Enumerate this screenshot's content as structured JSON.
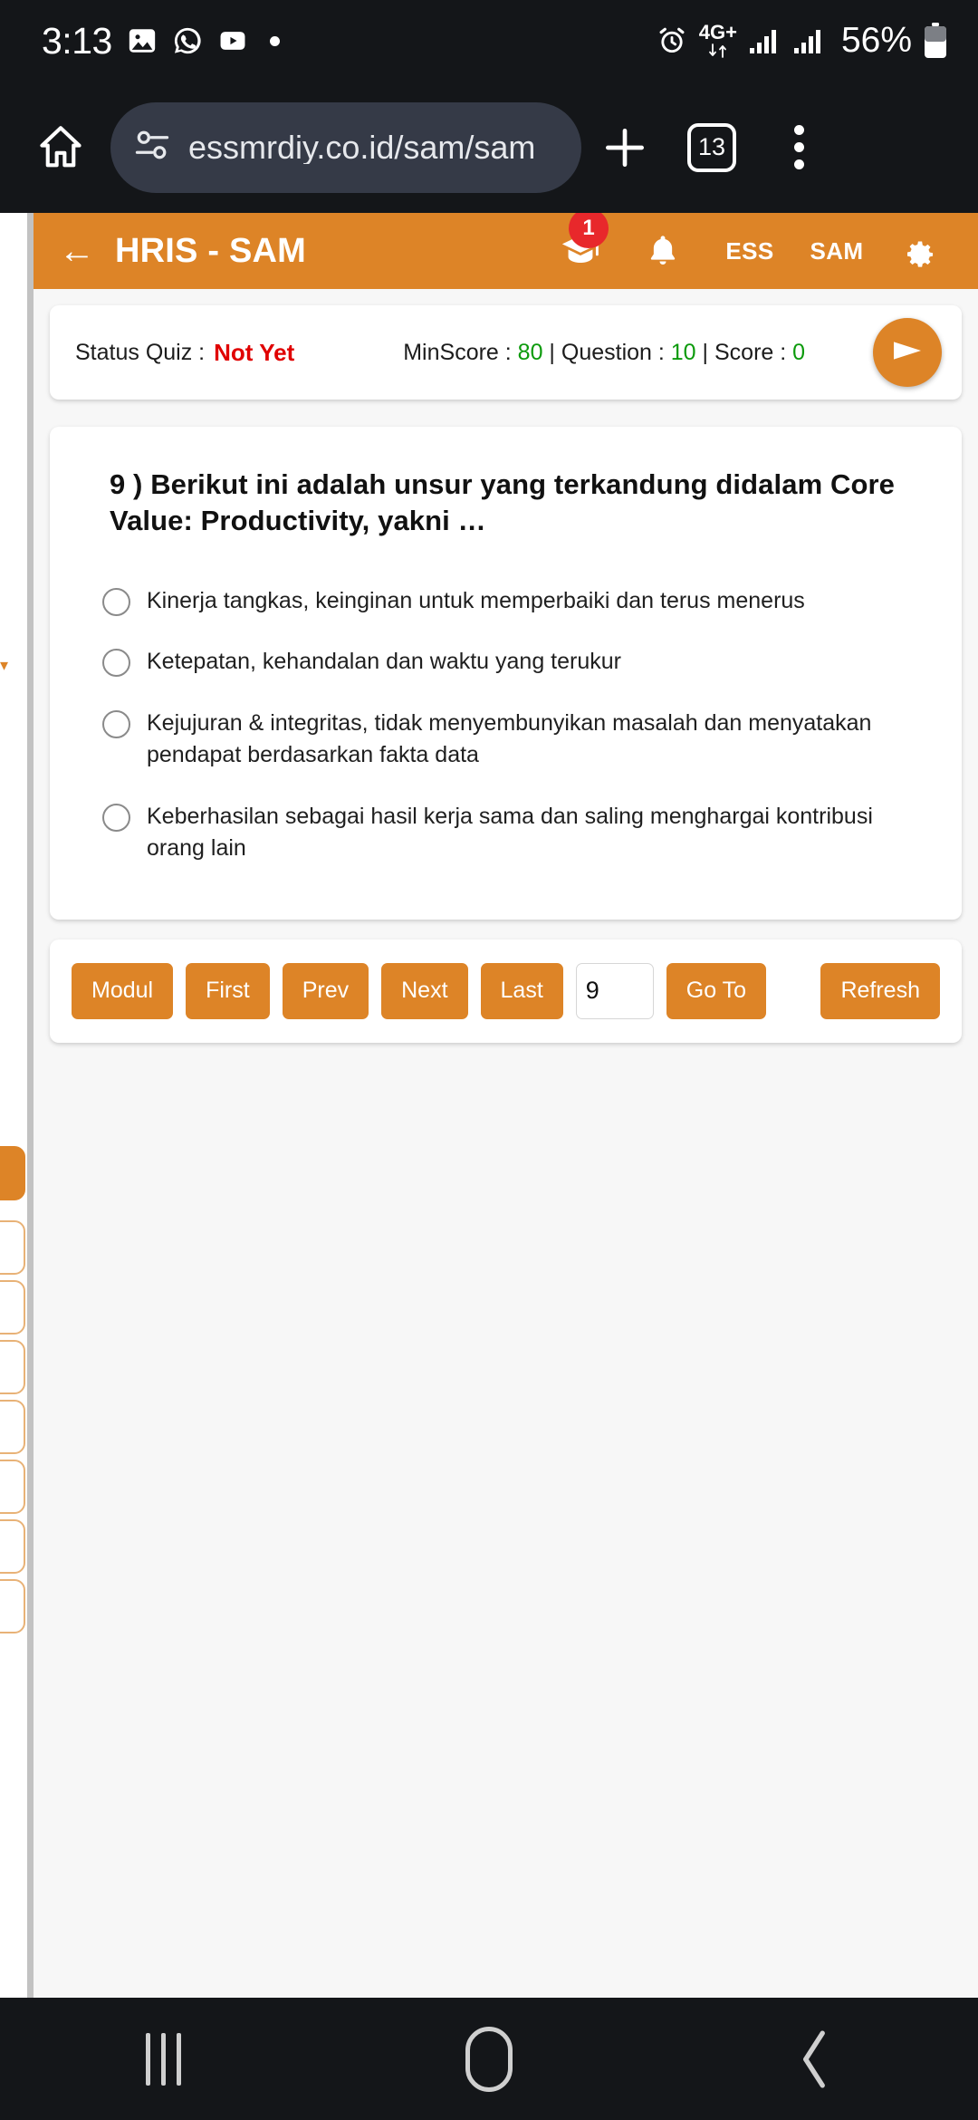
{
  "status_bar": {
    "time": "3:13",
    "left_icons": [
      "photos-icon",
      "whatsapp-icon",
      "youtube-icon",
      "more-notifications-dot"
    ],
    "alarm_icon": "alarm-icon",
    "network_type": "4G+",
    "signal_bars": [
      "signal-icon-sim1",
      "signal-icon-sim2"
    ],
    "battery_percent": "56%",
    "battery_icon": "battery-icon"
  },
  "browser": {
    "home_icon": "home-icon",
    "site_info_icon": "site-settings-icon",
    "url": "essmrdiy.co.id/sam/sam",
    "new_tab_icon": "plus-icon",
    "tab_count": "13",
    "menu_icon": "overflow-menu-icon"
  },
  "app_header": {
    "back_icon": "back-arrow-icon",
    "title": "HRIS - SAM",
    "learning_icon": "graduation-cap-icon",
    "learning_badge": "1",
    "notification_icon": "bell-icon",
    "ess_label": "ESS",
    "sam_label": "SAM",
    "settings_icon": "gear-icon",
    "accent_color": "#dd8427"
  },
  "status_card": {
    "status_label": "Status Quiz :",
    "status_value": "Not Yet",
    "status_value_color": "#e00000",
    "minscore_label": "MinScore :",
    "minscore_value": "80",
    "question_label": "Question :",
    "question_value": "10",
    "score_label": "Score :",
    "score_value": "0",
    "value_color": "#0b9a0b",
    "submit_icon": "send-arrow-icon"
  },
  "quiz": {
    "question_text": "9 ) Berikut ini adalah unsur yang terkandung didalam Core Value: Productivity, yakni …",
    "options": [
      {
        "text": "Kinerja tangkas, keinginan untuk memperbaiki dan terus menerus",
        "selected": false
      },
      {
        "text": "Ketepatan, kehandalan dan waktu yang terukur",
        "selected": false
      },
      {
        "text": "Kejujuran & integritas, tidak menyembunyikan masalah dan menyatakan pendapat berdasarkan fakta data",
        "selected": false
      },
      {
        "text": "Keberhasilan sebagai hasil kerja sama dan saling menghargai kontribusi orang lain",
        "selected": false
      }
    ]
  },
  "nav_bar_buttons": {
    "modul": "Modul",
    "first": "First",
    "prev": "Prev",
    "next": "Next",
    "last": "Last",
    "goto_value": "9",
    "goto": "Go To",
    "refresh": "Refresh"
  },
  "android_nav": {
    "recents_icon": "recents-icon",
    "home_icon": "home-button-icon",
    "back_icon": "back-button-icon"
  }
}
